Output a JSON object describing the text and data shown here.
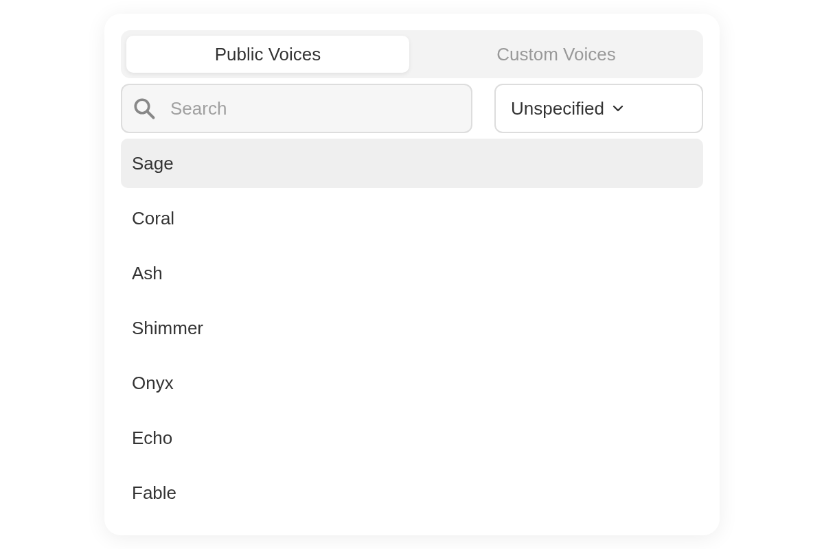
{
  "tabs": [
    {
      "label": "Public Voices",
      "selected": true
    },
    {
      "label": "Custom Voices",
      "selected": false
    }
  ],
  "search": {
    "placeholder": "Search"
  },
  "filter": {
    "value": "Unspecified"
  },
  "voices": [
    {
      "name": "Sage",
      "selected": true
    },
    {
      "name": "Coral",
      "selected": false
    },
    {
      "name": "Ash",
      "selected": false
    },
    {
      "name": "Shimmer",
      "selected": false
    },
    {
      "name": "Onyx",
      "selected": false
    },
    {
      "name": "Echo",
      "selected": false
    },
    {
      "name": "Fable",
      "selected": false
    }
  ]
}
